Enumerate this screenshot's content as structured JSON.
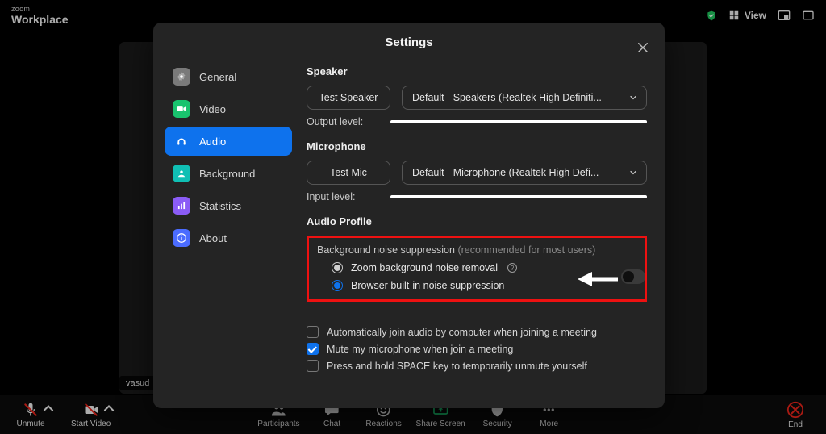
{
  "app": {
    "brand_small": "zoom",
    "brand": "Workplace",
    "view_label": "View",
    "participant_name": "vasud"
  },
  "toolbar": {
    "unmute": "Unmute",
    "start_video": "Start Video",
    "participants": "Participants",
    "chat": "Chat",
    "reactions": "Reactions",
    "share_screen": "Share Screen",
    "security": "Security",
    "more": "More",
    "end": "End"
  },
  "settings": {
    "title": "Settings",
    "nav": {
      "general": "General",
      "video": "Video",
      "audio": "Audio",
      "background": "Background",
      "statistics": "Statistics",
      "about": "About"
    },
    "audio": {
      "speaker_label": "Speaker",
      "test_speaker": "Test Speaker",
      "speaker_device": "Default - Speakers (Realtek High Definiti...",
      "output_level": "Output level:",
      "mic_label": "Microphone",
      "test_mic": "Test Mic",
      "mic_device": "Default - Microphone (Realtek High Defi...",
      "input_level": "Input level:",
      "audio_profile": "Audio Profile",
      "bns_title": "Background noise suppression",
      "bns_recommended": "(recommended for most users)",
      "bns_options": {
        "zoom": "Zoom background noise removal",
        "browser": "Browser built-in noise suppression",
        "selected": "browser"
      },
      "checks": {
        "auto_join": "Automatically join audio by computer when joining a meeting",
        "mute_on_join": "Mute my microphone when join a meeting",
        "space_unmute": "Press and hold SPACE key to temporarily unmute yourself"
      }
    }
  }
}
